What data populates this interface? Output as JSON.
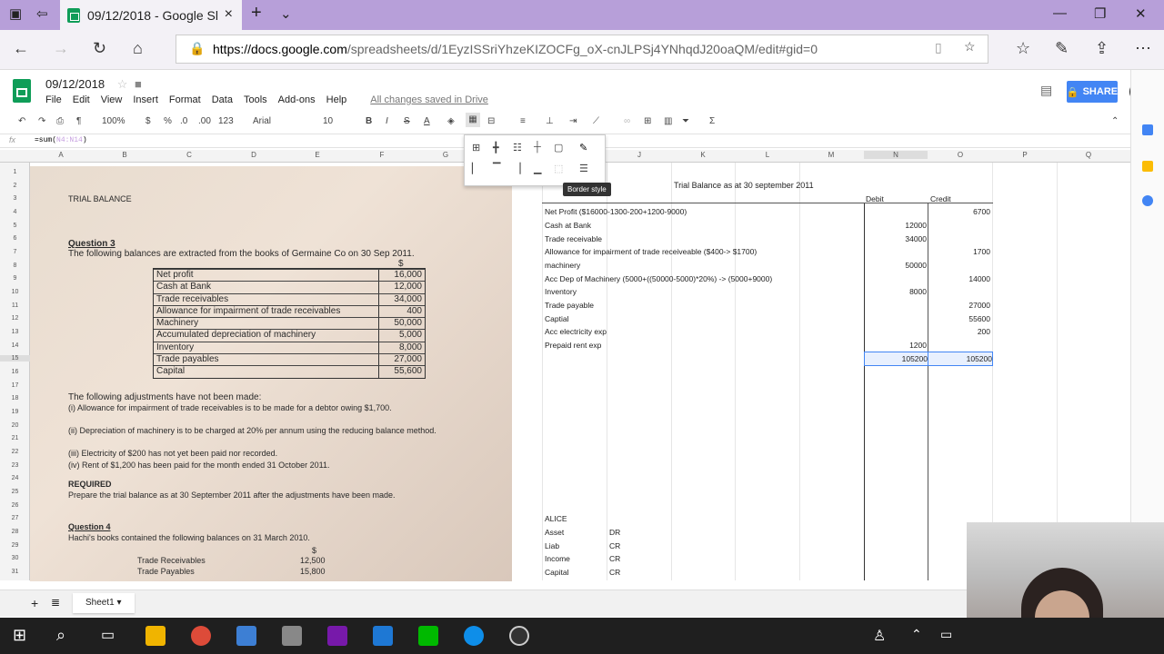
{
  "browser": {
    "tab_title": "09/12/2018 - Google Sl",
    "url_prefix": "https://docs.google.com",
    "url_rest": "/spreadsheets/d/1EyzISSriYhzeKIZOCFg_oX-cnJLPSj4YNhqdJ20oaQM/edit#gid=0"
  },
  "app": {
    "doc_title": "09/12/2018",
    "menus": [
      "File",
      "Edit",
      "View",
      "Insert",
      "Format",
      "Data",
      "Tools",
      "Add-ons",
      "Help"
    ],
    "saved_status": "All changes saved in Drive",
    "share_label": "SHARE"
  },
  "toolbar": {
    "zoom": "100%",
    "currency": "$",
    "percent": "%",
    "dec1": ".0",
    "dec2": ".00",
    "format123": "123",
    "font": "Arial",
    "size": "10",
    "bold": "B",
    "italic": "I",
    "strike": "S",
    "textcolor": "A"
  },
  "formula_bar": {
    "fx": "fx",
    "formula_prefix": "=sum(",
    "formula_ref": "N4:N14",
    "formula_suffix": ")"
  },
  "columns": [
    "A",
    "B",
    "C",
    "D",
    "E",
    "F",
    "G",
    "J",
    "K",
    "L",
    "M",
    "N",
    "O",
    "P",
    "Q"
  ],
  "rows": [
    "1",
    "2",
    "3",
    "4",
    "5",
    "6",
    "7",
    "8",
    "9",
    "10",
    "11",
    "12",
    "13",
    "14",
    "15",
    "16",
    "17",
    "18",
    "19",
    "20",
    "21",
    "22",
    "23",
    "24",
    "25",
    "26",
    "27",
    "28",
    "29",
    "30",
    "31"
  ],
  "photo": {
    "heading": "TRIAL BALANCE",
    "q3_title": "Question 3",
    "q3_text": "The following balances are extracted from the books of Germaine Co on 30 Sep 2011.",
    "currency_header": "$",
    "table": [
      {
        "label": "Net profit",
        "value": "16,000"
      },
      {
        "label": "Cash at Bank",
        "value": "12,000"
      },
      {
        "label": "Trade receivables",
        "value": "34,000"
      },
      {
        "label": "Allowance for impairment of trade receivables",
        "value": "400"
      },
      {
        "label": "Machinery",
        "value": "50,000"
      },
      {
        "label": "Accumulated depreciation of machinery",
        "value": "5,000"
      },
      {
        "label": "Inventory",
        "value": "8,000"
      },
      {
        "label": "Trade payables",
        "value": "27,000"
      },
      {
        "label": "Capital",
        "value": "55,600"
      }
    ],
    "adj_intro": "The following adjustments have not been made:",
    "adj1": "(i)    Allowance for impairment of trade receivables is to be made for a debtor owing $1,700.",
    "adj2": "(ii)   Depreciation of machinery is to be charged at 20% per annum using the reducing balance method.",
    "adj3": "(iii)  Electricity of $200 has not yet been paid nor recorded.",
    "adj4": "(iv)   Rent of $1,200 has been paid for the month ended 31 October 2011.",
    "required_title": "REQUIRED",
    "required_text": "Prepare the trial balance as at 30 September 2011 after the adjustments have been made.",
    "q4_title": "Question 4",
    "q4_text": "Hachi's books contained the following balances on 31 March 2010.",
    "q4_header": "$",
    "q4_row1_label": "Trade Receivables",
    "q4_row1_value": "12,500",
    "q4_row2_label": "Trade Payables",
    "q4_row2_value": "15,800"
  },
  "sheet": {
    "title": "Trial Balance as at 30 september 2011",
    "debit_header": "Debit",
    "credit_header": "Credit",
    "rows": [
      {
        "label": "Net Profit ($16000-1300-200+1200-9000)",
        "debit": "",
        "credit": "6700"
      },
      {
        "label": "Cash at Bank",
        "debit": "12000",
        "credit": ""
      },
      {
        "label": "Trade receivable",
        "debit": "34000",
        "credit": ""
      },
      {
        "label": "Allowance for impairment of trade receiveable ($400-> $1700)",
        "debit": "",
        "credit": "1700"
      },
      {
        "label": "machinery",
        "debit": "50000",
        "credit": ""
      },
      {
        "label": "Acc Dep of Machinery (5000+((50000-5000)*20%) -> (5000+9000)",
        "debit": "",
        "credit": "14000"
      },
      {
        "label": "Inventory",
        "debit": "8000",
        "credit": ""
      },
      {
        "label": "Trade payable",
        "debit": "",
        "credit": "27000"
      },
      {
        "label": "Captial",
        "debit": "",
        "credit": "55600"
      },
      {
        "label": "Acc electricity exp",
        "debit": "",
        "credit": "200"
      },
      {
        "label": "Prepaid rent exp",
        "debit": "1200",
        "credit": ""
      }
    ],
    "total_debit": "105200",
    "total_credit": "105200",
    "alice_title": "ALICE",
    "alice_rows": [
      {
        "label": "Asset",
        "side": "DR"
      },
      {
        "label": "Liab",
        "side": "CR"
      },
      {
        "label": "Income",
        "side": "CR"
      },
      {
        "label": "Capital",
        "side": "CR"
      }
    ]
  },
  "border_popup": {
    "tooltip": "Border style"
  },
  "sheet_tab": "Sheet1"
}
